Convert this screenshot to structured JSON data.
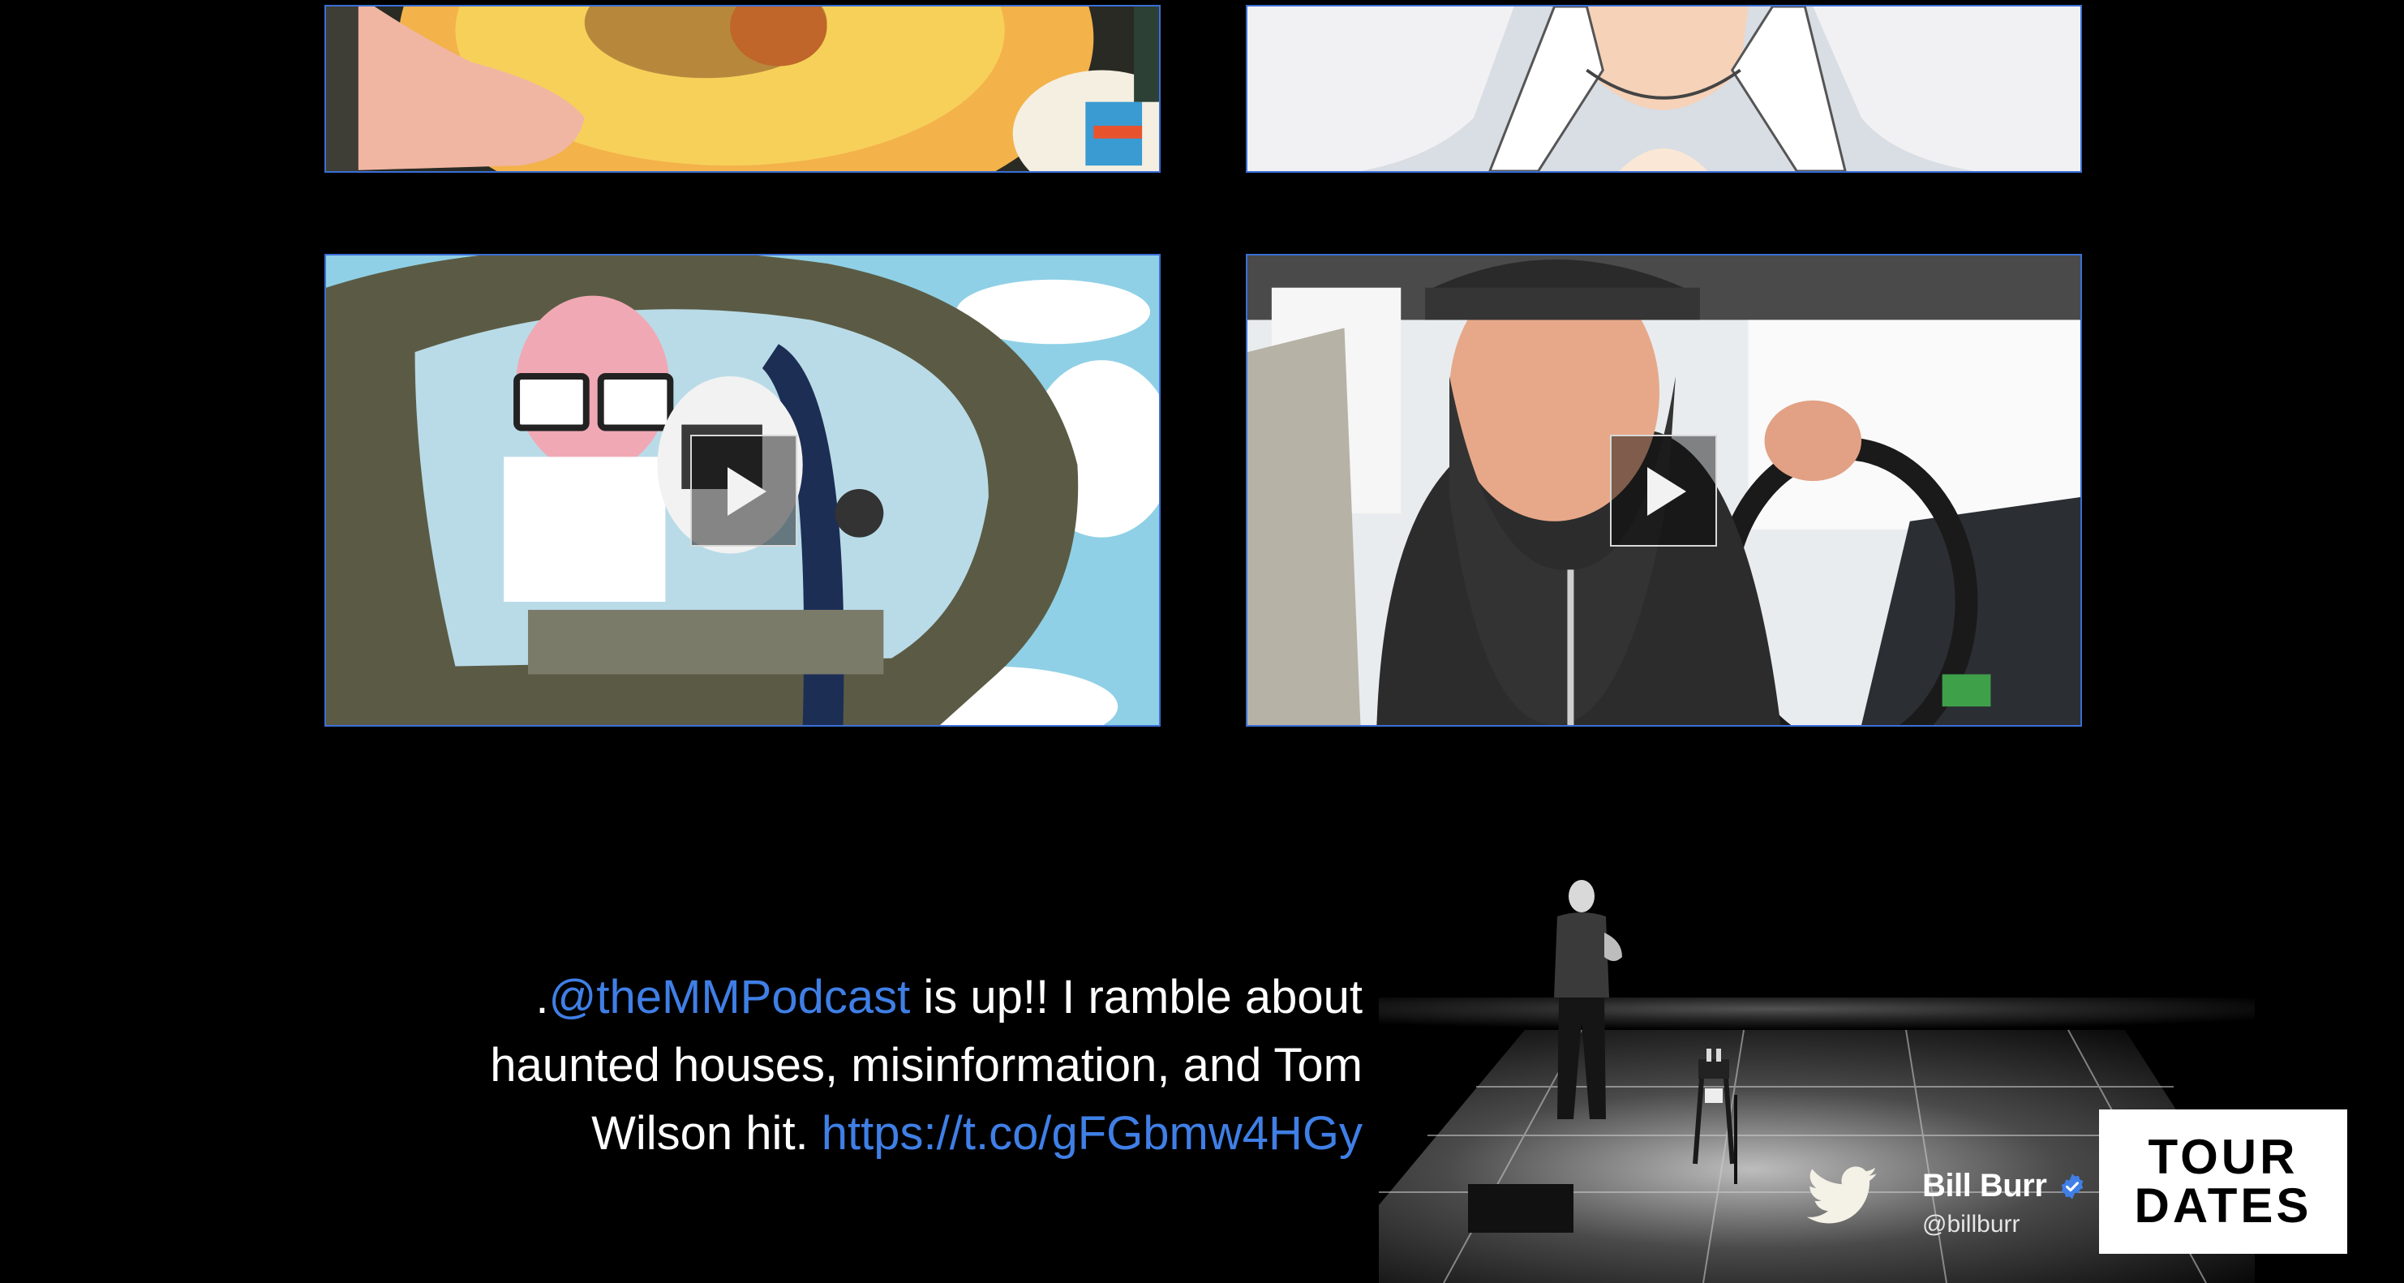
{
  "videos": [
    {
      "thumb": "cooking-bowl",
      "has_play": false
    },
    {
      "thumb": "anime-character",
      "has_play": false
    },
    {
      "thumb": "cartoon-helicopter",
      "has_play": true
    },
    {
      "thumb": "man-driving-truck",
      "has_play": true
    }
  ],
  "tweet": {
    "prefix": ".",
    "mention": "@theMMPodcast",
    "body": " is up!! I ramble about haunted houses, misinformation, and Tom Wilson hit. ",
    "url": "https://t.co/gFGbmw4HGy"
  },
  "author": {
    "name": "Bill Burr",
    "handle": "@billburr",
    "verified": true
  },
  "tour": {
    "line1": "TOUR",
    "line2": "DATES"
  },
  "colors": {
    "background": "#000000",
    "link": "#3f7fe6",
    "tile_border": "#3b6fd6",
    "verified_badge": "#3f7fe6"
  },
  "icons": [
    "play-icon",
    "twitter-bird-icon",
    "verified-badge-icon"
  ]
}
